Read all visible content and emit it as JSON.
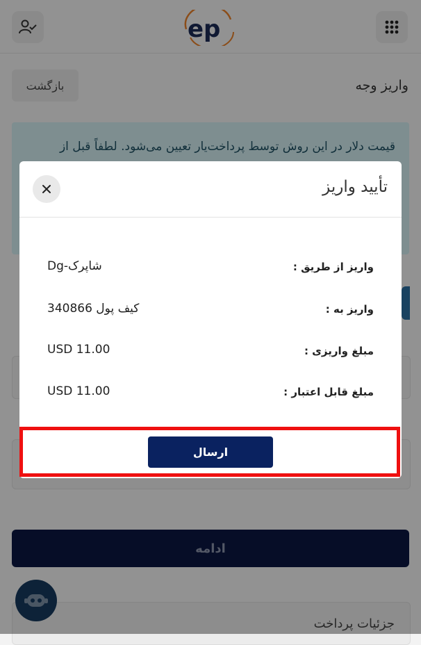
{
  "header": {
    "logo_text": "ep",
    "left_icon": "user-check-icon",
    "right_icon": "grid-menu-icon"
  },
  "page": {
    "title": "واریز وجه",
    "back_label": "بازگشت",
    "info_text": "قیمت دلار در این روش توسط پرداخت‌یار تعیین می‌شود. لطفاً قبل از",
    "continue_label": "ادامه",
    "details_title": "جزئیات پرداخت"
  },
  "modal": {
    "title": "تأیید واریز",
    "rows": [
      {
        "label": "واریز از طریق :",
        "value": "Dg-شاپرک"
      },
      {
        "label": "واریز به :",
        "value": "کیف پول 340866"
      },
      {
        "label": "مبلغ واریزی :",
        "value": "USD 11.00"
      },
      {
        "label": "مبلغ قابل اعتبار :",
        "value": "USD 11.00"
      }
    ],
    "submit_label": "ارسال"
  },
  "colors": {
    "primary": "#0a2260",
    "highlight": "#ef1010",
    "info_bg": "#d2edf1"
  }
}
